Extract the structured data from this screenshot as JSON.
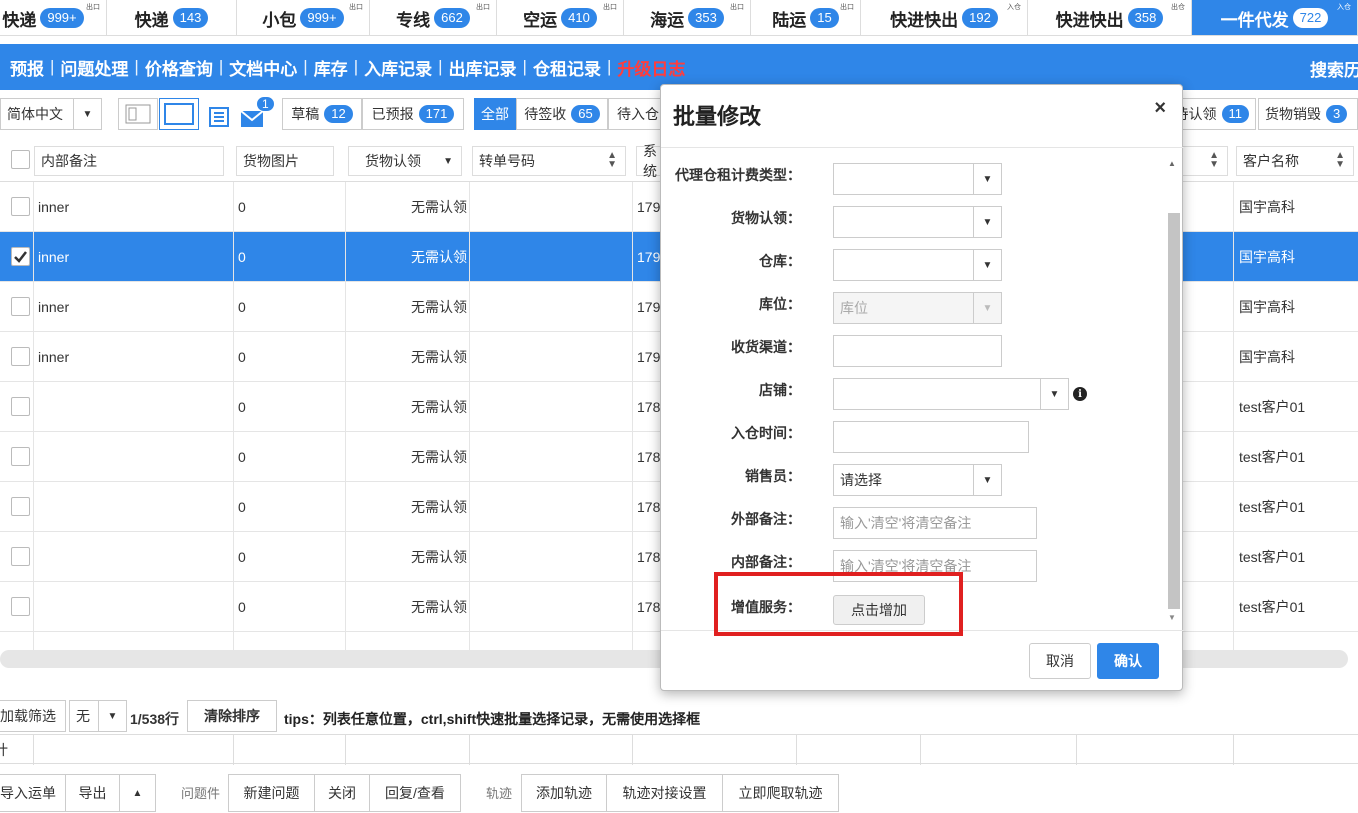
{
  "top_tabs": [
    {
      "label": "快递",
      "badge": "999+",
      "tag": "出口"
    },
    {
      "label": "快递",
      "badge": "143",
      "tag": ""
    },
    {
      "label": "小包",
      "badge": "999+",
      "tag": "出口"
    },
    {
      "label": "专线",
      "badge": "662",
      "tag": "出口"
    },
    {
      "label": "空运",
      "badge": "410",
      "tag": "出口"
    },
    {
      "label": "海运",
      "badge": "353",
      "tag": "出口"
    },
    {
      "label": "陆运",
      "badge": "15",
      "tag": "出口"
    },
    {
      "label": "快进快出",
      "badge": "192",
      "tag": "入仓"
    },
    {
      "label": "快进快出",
      "badge": "358",
      "tag": "出仓"
    },
    {
      "label": "一件代发",
      "badge": "722",
      "tag": "入仓"
    }
  ],
  "nav": {
    "items": [
      "预报",
      "问题处理",
      "价格查询",
      "文档中心",
      "库存",
      "入库记录",
      "出库记录",
      "仓租记录",
      "升级日志"
    ],
    "search": "搜索历史"
  },
  "toolbar": {
    "language": "简体中文",
    "mail_count": "1",
    "draft": "草稿",
    "draft_count": "12",
    "prereported": "已预报",
    "prereported_count": "171",
    "all": "全部",
    "pending_sign": "待签收",
    "pending_sign_count": "65",
    "pending_in": "待入仓",
    "claim": "待认领",
    "claim_count": "11",
    "destroy": "货物销毁",
    "destroy_count": "3"
  },
  "table": {
    "headers": {
      "inner_note": "内部备注",
      "image": "货物图片",
      "claim": "货物认领",
      "transfer": "转单号码",
      "sys": "系统",
      "customer": "客户名称"
    },
    "rows": [
      {
        "note": "inner",
        "img": "0",
        "claim": "无需认领",
        "sys": "179",
        "customer": "国宇高科",
        "selected": false
      },
      {
        "note": "inner",
        "img": "0",
        "claim": "无需认领",
        "sys": "179",
        "customer": "国宇高科",
        "selected": true
      },
      {
        "note": "inner",
        "img": "0",
        "claim": "无需认领",
        "sys": "179",
        "customer": "国宇高科",
        "selected": false
      },
      {
        "note": "inner",
        "img": "0",
        "claim": "无需认领",
        "sys": "179",
        "customer": "国宇高科",
        "selected": false
      },
      {
        "note": "",
        "img": "0",
        "claim": "无需认领",
        "sys": "178",
        "customer": "test客户01",
        "selected": false
      },
      {
        "note": "",
        "img": "0",
        "claim": "无需认领",
        "sys": "178",
        "customer": "test客户01",
        "selected": false
      },
      {
        "note": "",
        "img": "0",
        "claim": "无需认领",
        "sys": "178",
        "customer": "test客户01",
        "selected": false
      },
      {
        "note": "",
        "img": "0",
        "claim": "无需认领",
        "sys": "178",
        "customer": "test客户01",
        "selected": false
      },
      {
        "note": "",
        "img": "0",
        "claim": "无需认领",
        "sys": "178",
        "customer": "test客户01",
        "selected": false
      }
    ]
  },
  "status": {
    "load_filter": "加载筛选",
    "none": "无",
    "rows": "1/538行",
    "clear_sort": "清除排序",
    "tips": "tips：列表任意位置，ctrl,shift快速批量选择记录，无需使用选择框",
    "footer_cell": "计"
  },
  "bottom": {
    "import": "导入运单",
    "export": "导出",
    "issue_label": "问题件",
    "new_issue": "新建问题",
    "close": "关闭",
    "reply": "回复/查看",
    "track_label": "轨迹",
    "add_track": "添加轨迹",
    "track_setting": "轨迹对接设置",
    "crawl": "立即爬取轨迹"
  },
  "modal": {
    "title": "批量修改",
    "close": "×",
    "fields": {
      "rent_type": "代理仓租计费类型：",
      "claim": "货物认领：",
      "warehouse": "仓库：",
      "location": "库位：",
      "location_placeholder": "库位",
      "channel": "收货渠道：",
      "shop": "店铺：",
      "in_time": "入仓时间：",
      "sales": "销售员：",
      "sales_value": "请选择",
      "ext_note": "外部备注：",
      "ext_note_placeholder": "输入'清空'将清空备注",
      "int_note": "内部备注：",
      "int_note_placeholder": "输入'清空'将清空备注",
      "service": "增值服务：",
      "service_btn": "点击增加"
    },
    "cancel": "取消",
    "confirm": "确认"
  }
}
